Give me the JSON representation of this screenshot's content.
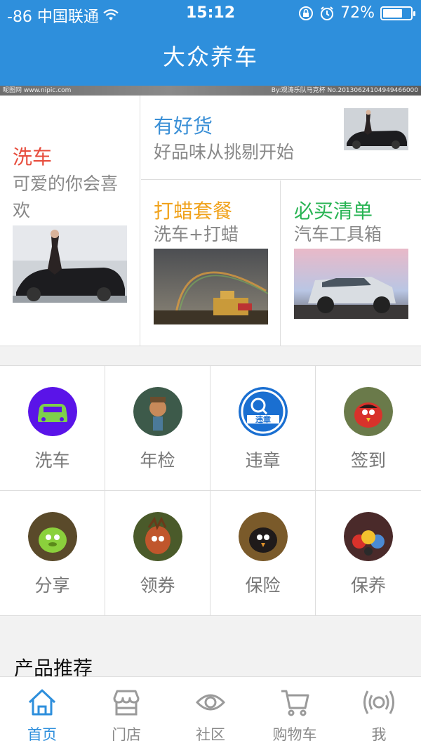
{
  "status_bar": {
    "carrier": "-86 中国联通",
    "time": "15:12",
    "battery_percent": "72%",
    "battery_level": 0.72
  },
  "nav": {
    "title": "大众养车"
  },
  "banner": {
    "watermark_left": "昵图网 www.nipic.com",
    "watermark_right": "By:观涛乐队马克杯 No.20130624104949466000"
  },
  "promo": {
    "left": {
      "title": "洗车",
      "subtitle": "可爱的你会喜欢",
      "image": "car-model-photo",
      "color": "#e74c3c"
    },
    "top_right": {
      "title": "有好货",
      "subtitle": "好品味从挑剔开始",
      "image": "car-model-photo",
      "color": "#3a8fd6"
    },
    "bottom_left": {
      "title": "打蜡套餐",
      "subtitle": "洗车+打蜡",
      "image": "rainbow-city-photo",
      "color": "#f0a21b"
    },
    "bottom_right": {
      "title": "必买清单",
      "subtitle": "汽车工具箱",
      "image": "suv-photo",
      "color": "#29b454"
    }
  },
  "services": [
    {
      "label": "洗车",
      "icon": "car-wash-icon"
    },
    {
      "label": "年检",
      "icon": "inspection-icon"
    },
    {
      "label": "违章",
      "icon": "violation-icon"
    },
    {
      "label": "签到",
      "icon": "checkin-icon"
    },
    {
      "label": "分享",
      "icon": "share-icon"
    },
    {
      "label": "领券",
      "icon": "coupon-icon"
    },
    {
      "label": "保险",
      "icon": "insurance-icon"
    },
    {
      "label": "保养",
      "icon": "maintenance-icon"
    }
  ],
  "section": {
    "products_title": "产品推荐"
  },
  "tabs": [
    {
      "label": "首页",
      "icon": "home-icon",
      "active": true
    },
    {
      "label": "门店",
      "icon": "store-icon",
      "active": false
    },
    {
      "label": "社区",
      "icon": "eye-icon",
      "active": false
    },
    {
      "label": "购物车",
      "icon": "cart-icon",
      "active": false
    },
    {
      "label": "我",
      "icon": "profile-icon",
      "active": false
    }
  ],
  "colors": {
    "primary": "#2e8fdc"
  }
}
